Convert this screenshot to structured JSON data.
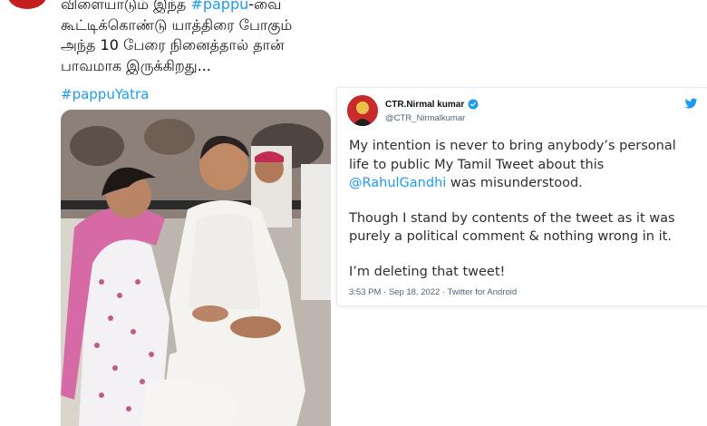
{
  "left_tweet": {
    "text_lines": [
      {
        "pre": "விளையாடும் இந்த ",
        "mention": "#pappu",
        "post": "-வை"
      },
      {
        "pre": "கூட்டிக்கொண்டு யாத்திரை போகும்",
        "mention": "",
        "post": ""
      },
      {
        "pre": "அந்த 10 பேரை நினைத்தால் தான்",
        "mention": "",
        "post": ""
      },
      {
        "pre": "பாவமாக இருக்கிறது...",
        "mention": "",
        "post": ""
      }
    ],
    "hashtag": "#pappuYatra",
    "accent_color": "#1d9bf0"
  },
  "embedded_tweet": {
    "name": "CTR.Nirmal kumar",
    "handle": "@CTR_Nirmalkumar",
    "verified": true,
    "icons": [
      "verified-badge-icon",
      "twitter-bird-icon"
    ],
    "paragraph1_pre": "My intention is never to bring anybody’s personal life to public My Tamil Tweet about this ",
    "paragraph1_mention": "@RahulGandhi",
    "paragraph1_post": " was misunderstood.",
    "paragraph2": "Though I stand by contents of the tweet as it was purely a political comment & nothing wrong in it.",
    "paragraph3": "I’m deleting that tweet!",
    "meta": "3:53 PM · Sep 18, 2022 · Twitter for Android"
  }
}
